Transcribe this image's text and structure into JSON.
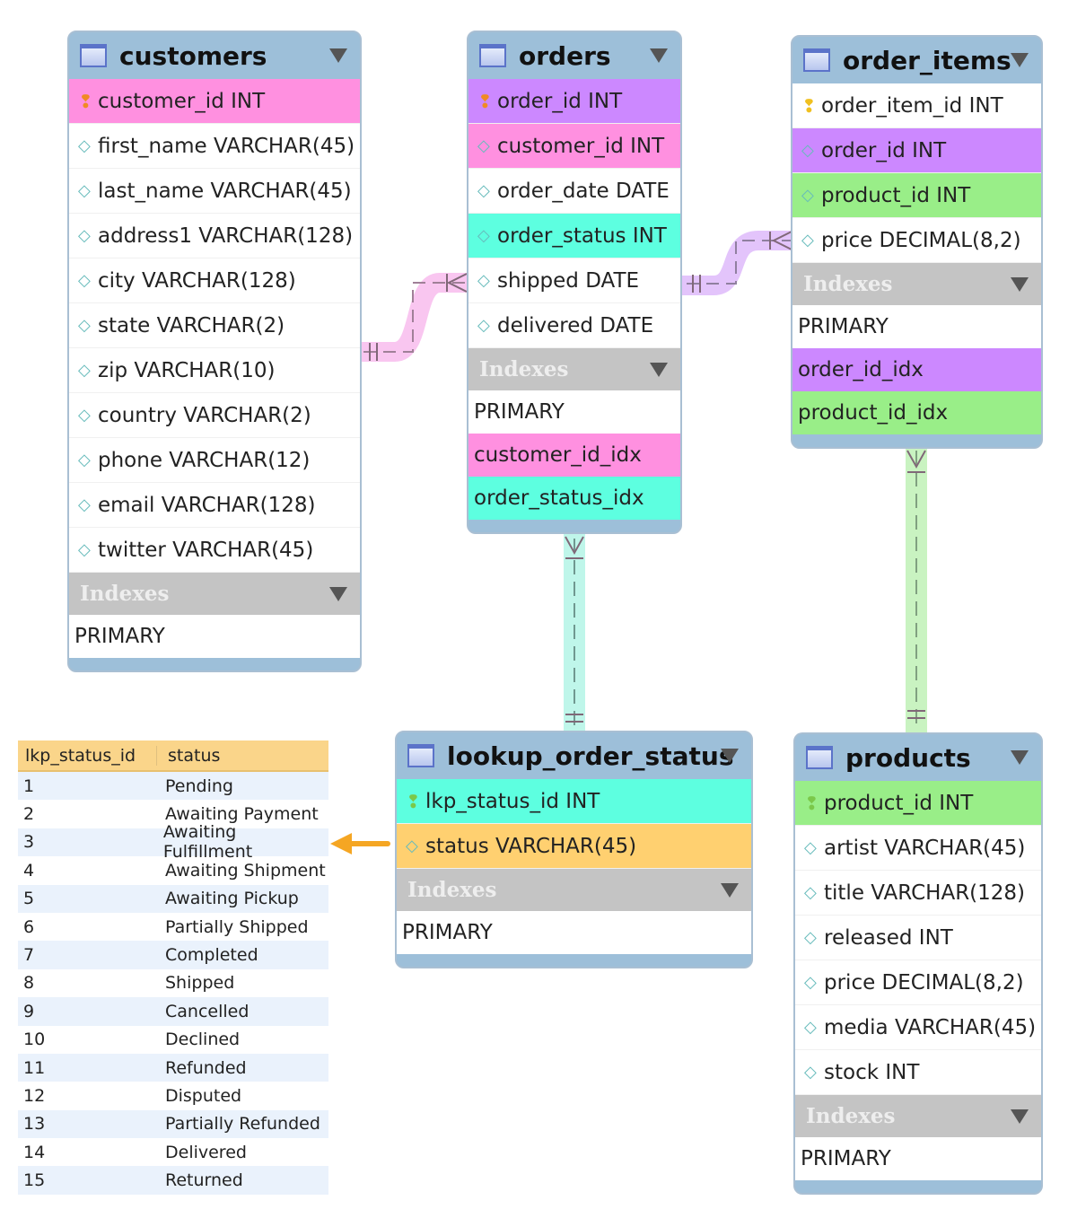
{
  "tables": [
    {
      "id": "customers",
      "name": "customers",
      "columns": [
        {
          "label": "customer_id INT",
          "key": "primary",
          "color": "#ff90e0"
        },
        {
          "label": "first_name VARCHAR(45)"
        },
        {
          "label": "last_name VARCHAR(45)"
        },
        {
          "label": "address1 VARCHAR(128)"
        },
        {
          "label": "city VARCHAR(128)"
        },
        {
          "label": "state VARCHAR(2)"
        },
        {
          "label": "zip VARCHAR(10)"
        },
        {
          "label": "country VARCHAR(2)"
        },
        {
          "label": "phone VARCHAR(12)"
        },
        {
          "label": "email VARCHAR(128)"
        },
        {
          "label": "twitter VARCHAR(45)"
        }
      ],
      "indexes_label": "Indexes",
      "indexes": [
        {
          "label": "PRIMARY"
        }
      ]
    },
    {
      "id": "orders",
      "name": "orders",
      "columns": [
        {
          "label": "order_id INT",
          "key": "primary",
          "color": "#cc88ff"
        },
        {
          "label": "customer_id INT",
          "color": "#ff90e0"
        },
        {
          "label": "order_date DATE"
        },
        {
          "label": "order_status INT",
          "color": "#5dffe0"
        },
        {
          "label": "shipped DATE"
        },
        {
          "label": "delivered DATE"
        }
      ],
      "indexes_label": "Indexes",
      "indexes": [
        {
          "label": "PRIMARY"
        },
        {
          "label": "customer_id_idx",
          "color": "#ff90e0"
        },
        {
          "label": "order_status_idx",
          "color": "#5dffe0"
        }
      ]
    },
    {
      "id": "order_items",
      "name": "order_items",
      "columns": [
        {
          "label": "order_item_id INT",
          "key": "primary-yellow"
        },
        {
          "label": "order_id INT",
          "color": "#cc88ff"
        },
        {
          "label": "product_id INT",
          "color": "#99ee88"
        },
        {
          "label": "price DECIMAL(8,2)"
        }
      ],
      "indexes_label": "Indexes",
      "indexes": [
        {
          "label": "PRIMARY"
        },
        {
          "label": "order_id_idx",
          "color": "#cc88ff"
        },
        {
          "label": "product_id_idx",
          "color": "#99ee88"
        }
      ]
    },
    {
      "id": "lookup_order_status",
      "name": "lookup_order_status",
      "columns": [
        {
          "label": "lkp_status_id INT",
          "key": "primary-green",
          "color": "#5dffe0"
        },
        {
          "label": "status VARCHAR(45)",
          "color": "#ffd070"
        }
      ],
      "indexes_label": "Indexes",
      "indexes": [
        {
          "label": "PRIMARY"
        }
      ]
    },
    {
      "id": "products",
      "name": "products",
      "columns": [
        {
          "label": "product_id INT",
          "key": "primary-green",
          "color": "#99ee88"
        },
        {
          "label": "artist VARCHAR(45)"
        },
        {
          "label": "title VARCHAR(128)"
        },
        {
          "label": "released INT"
        },
        {
          "label": "price DECIMAL(8,2)"
        },
        {
          "label": "media VARCHAR(45)"
        },
        {
          "label": "stock INT"
        }
      ],
      "indexes_label": "Indexes",
      "indexes": [
        {
          "label": "PRIMARY"
        }
      ]
    }
  ],
  "lookup_data": {
    "headers": [
      "lkp_status_id",
      "status"
    ],
    "rows": [
      [
        "1",
        "Pending"
      ],
      [
        "2",
        "Awaiting Payment"
      ],
      [
        "3",
        "Awaiting Fulfillment"
      ],
      [
        "4",
        "Awaiting Shipment"
      ],
      [
        "5",
        "Awaiting Pickup"
      ],
      [
        "6",
        "Partially Shipped"
      ],
      [
        "7",
        "Completed"
      ],
      [
        "8",
        "Shipped"
      ],
      [
        "9",
        "Cancelled"
      ],
      [
        "10",
        "Declined"
      ],
      [
        "11",
        "Refunded"
      ],
      [
        "12",
        "Disputed"
      ],
      [
        "13",
        "Partially Refunded"
      ],
      [
        "14",
        "Delivered"
      ],
      [
        "15",
        "Returned"
      ]
    ]
  },
  "colors": {
    "header": "#9dbfd9",
    "indexes": "#c4c4c4",
    "arrow": "#f5a623",
    "lookup_header": "#fad58a"
  }
}
